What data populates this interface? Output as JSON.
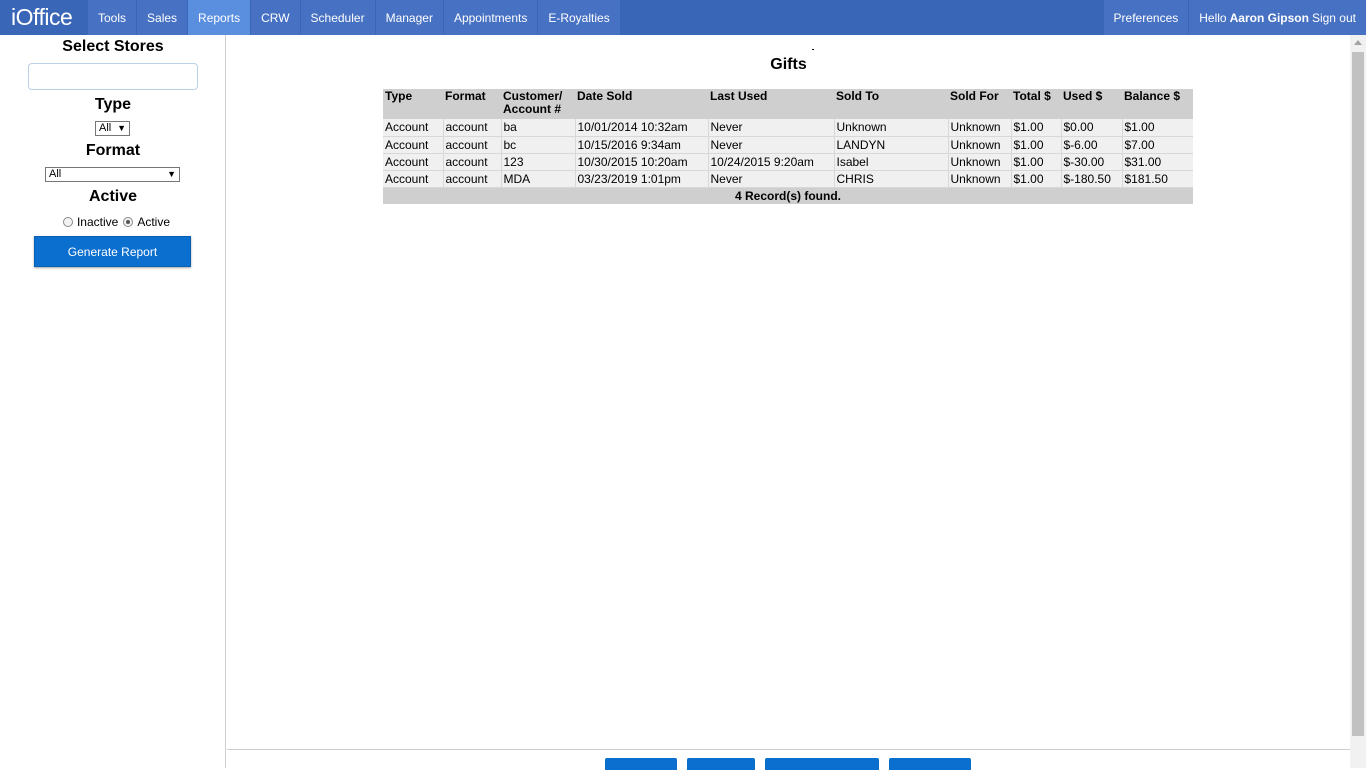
{
  "app": {
    "brand": "iOffice"
  },
  "nav": {
    "items": [
      {
        "label": "Tools"
      },
      {
        "label": "Sales"
      },
      {
        "label": "Reports"
      },
      {
        "label": "CRW"
      },
      {
        "label": "Scheduler"
      },
      {
        "label": "Manager"
      },
      {
        "label": "Appointments"
      },
      {
        "label": "E-Royalties"
      }
    ],
    "active": "Reports",
    "preferences": "Preferences",
    "greeting": "Hello",
    "user": "Aaron Gipson",
    "signout": "Sign out"
  },
  "sidebar": {
    "stores_heading": "Select Stores",
    "stores_value": "",
    "type_heading": "Type",
    "type_selected": "All",
    "format_heading": "Format",
    "format_selected": "All",
    "active_heading": "Active",
    "radio_inactive": "Inactive",
    "radio_active": "Active",
    "radio_selected": "Active",
    "generate_label": "Generate Report"
  },
  "report": {
    "title": "Gifts",
    "columns": [
      "Type",
      "Format",
      "Customer/ Account #",
      "Date Sold",
      "Last Used",
      "Sold To",
      "Sold For",
      "Total $",
      "Used $",
      "Balance $"
    ],
    "rows": [
      [
        "Account",
        "account",
        "ba",
        "10/01/2014 10:32am",
        "Never",
        "Unknown",
        "Unknown",
        "$1.00",
        "$0.00",
        "$1.00"
      ],
      [
        "Account",
        "account",
        "bc",
        "10/15/2016 9:34am",
        "Never",
        "LANDYN",
        "Unknown",
        "$1.00",
        "$-6.00",
        "$7.00"
      ],
      [
        "Account",
        "account",
        "123",
        "10/30/2015 10:20am",
        "10/24/2015 9:20am",
        "Isabel",
        "Unknown",
        "$1.00",
        "$-30.00",
        "$31.00"
      ],
      [
        "Account",
        "account",
        "MDA",
        "03/23/2019 1:01pm",
        "Never",
        "CHRIS",
        "Unknown",
        "$1.00",
        "$-180.50",
        "$181.50"
      ]
    ],
    "footer": "4 Record(s) found."
  },
  "colors": {
    "navbar": "#3a66b8",
    "nav_item": "#4771c2",
    "nav_active": "#5a8fe0",
    "primary_button": "#0b6fcf",
    "table_header": "#cfcfcf",
    "table_row": "#f0f0f0"
  }
}
